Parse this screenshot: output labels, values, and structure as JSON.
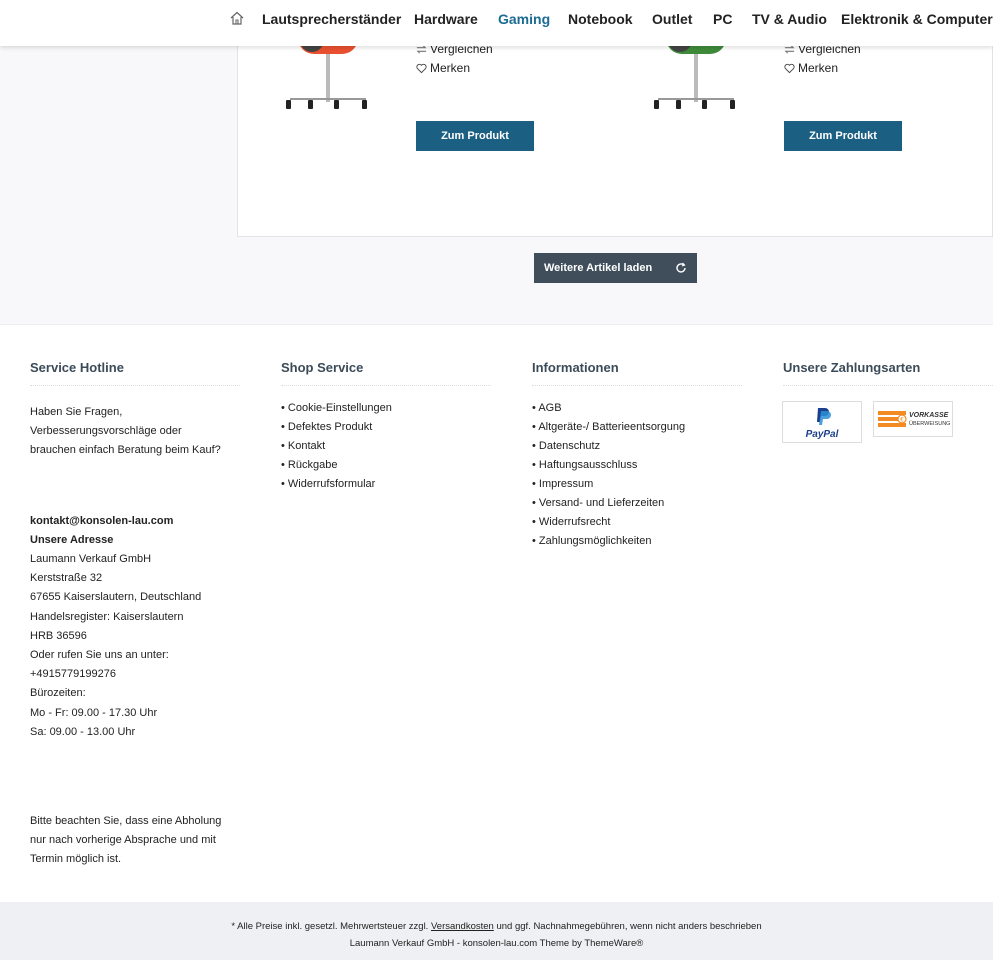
{
  "nav": {
    "items": [
      "Lautsprecherständer",
      "Hardware",
      "Gaming",
      "Notebook",
      "Outlet",
      "PC",
      "TV & Audio",
      "Elektronik & Computer"
    ],
    "active": "Gaming"
  },
  "products": [
    {
      "compare": "Vergleichen",
      "wishlist": "Merken",
      "button": "Zum Produkt",
      "color": "#e8502f"
    },
    {
      "compare": "Vergleichen",
      "wishlist": "Merken",
      "button": "Zum Produkt",
      "color": "#3e8a3a"
    }
  ],
  "load_more": "Weitere Artikel laden",
  "footer": {
    "hotline": {
      "title": "Service Hotline",
      "question": [
        "Haben Sie Fragen,",
        "Verbesserungsvorschläge oder",
        "brauchen einfach Beratung beim Kauf?"
      ],
      "email": "kontakt@konsolen-lau.com",
      "address_title": "Unsere Adresse",
      "address": [
        "Laumann Verkauf GmbH",
        "Kerststraße 32",
        "67655 Kaiserslautern, Deutschland",
        "Handelsregister: Kaiserslautern",
        "HRB 36596",
        "Oder rufen Sie uns an unter:",
        "+4915779199276",
        "Bürozeiten:",
        "Mo - Fr: 09.00 - 17.30 Uhr",
        "Sa: 09.00 - 13.00 Uhr"
      ],
      "note": [
        "Bitte beachten Sie, dass eine Abholung",
        "nur nach vorherige Absprache und mit",
        "Termin möglich ist."
      ]
    },
    "shop_service": {
      "title": "Shop Service",
      "items": [
        "Cookie-Einstellungen",
        "Defektes Produkt",
        "Kontakt",
        "Rückgabe",
        "Widerrufsformular"
      ]
    },
    "info": {
      "title": "Informationen",
      "items": [
        "AGB",
        "Altgeräte-/ Batterieentsorgung",
        "Datenschutz",
        "Haftungsausschluss",
        "Impressum",
        "Versand- und Lieferzeiten",
        "Widerrufsrecht",
        "Zahlungsmöglichkeiten"
      ]
    },
    "payment": {
      "title": "Unsere Zahlungsarten",
      "paypal": "PayPal",
      "vorkasse": "VORKASSE",
      "ueberweisung": "ÜBERWEISUNG"
    }
  },
  "bottom": {
    "vat_pre": "* Alle Preise inkl. gesetzl. Mehrwertsteuer zzgl.",
    "vat_link": "Versandkosten",
    "vat_post": "und ggf. Nachnahmegebühren, wenn nicht anders beschrieben",
    "credit": "Laumann Verkauf GmbH - konsolen-lau.com Theme by ThemeWare®"
  }
}
